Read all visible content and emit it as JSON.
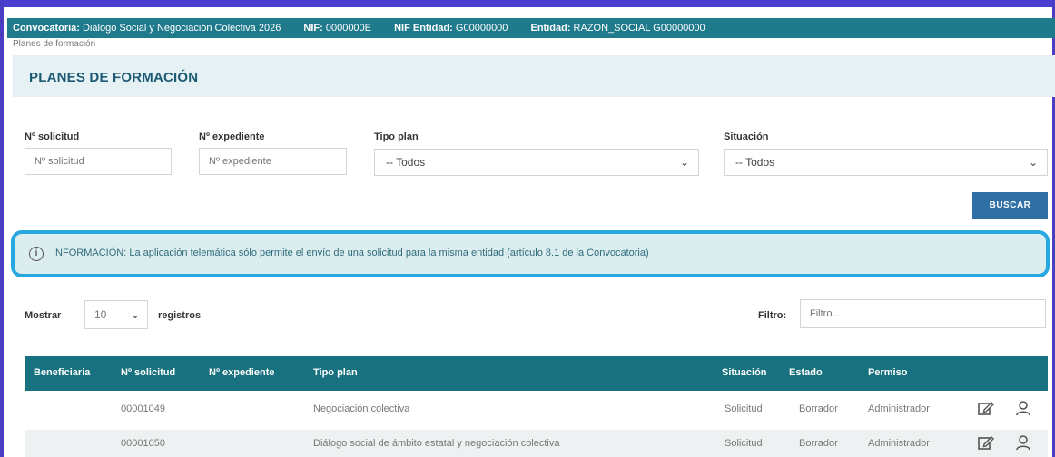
{
  "header": {
    "convocatoria_label": "Convocatoria:",
    "convocatoria_value": "Diálogo Social y Negociación Colectiva 2026",
    "nif_label": "NIF:",
    "nif_value": "0000000E",
    "nif_entidad_label": "NIF Entidad:",
    "nif_entidad_value": "G00000000",
    "entidad_label": "Entidad:",
    "entidad_value": "RAZON_SOCIAL G00000000"
  },
  "breadcrumb": "Planes de formación",
  "page_title": "PLANES DE FORMACIÓN",
  "filters": {
    "solicitud_label": "Nº solicitud",
    "solicitud_placeholder": "Nº solicitud",
    "expediente_label": "Nº expediente",
    "expediente_placeholder": "Nº expediente",
    "tipo_plan_label": "Tipo plan",
    "tipo_plan_value": "-- Todos",
    "situacion_label": "Situación",
    "situacion_value": "-- Todos",
    "search_button": "BUSCAR"
  },
  "info": {
    "text": "INFORMACIÓN: La aplicación telemática sólo permite el envío de una solicitud para la misma entidad (artículo 8.1 de la Convocatoria)"
  },
  "table_controls": {
    "mostrar_label": "Mostrar",
    "page_length": "10",
    "registros_label": "registros",
    "filtro_label": "Filtro:",
    "filtro_placeholder": "Filtro..."
  },
  "table": {
    "columns": [
      "Beneficiaria",
      "Nº solicitud",
      "Nº expediente",
      "Tipo plan",
      "Situación",
      "Estado",
      "Permiso"
    ],
    "rows": [
      {
        "beneficiaria": "",
        "solicitud": "00001049",
        "expediente": "",
        "tipo_plan": "Negociación colectiva",
        "situacion": "Solicitud",
        "estado": "Borrador",
        "permiso": "Administrador"
      },
      {
        "beneficiaria": "",
        "solicitud": "00001050",
        "expediente": "",
        "tipo_plan": "Diálogo social de ámbito estatal y negociación colectiva",
        "situacion": "Solicitud",
        "estado": "Borrador",
        "permiso": "Administrador"
      }
    ]
  },
  "colors": {
    "header_bg": "#1f7a8c",
    "table_head_bg": "#17717f",
    "button_bg": "#2f6fa6",
    "info_border": "#29a8df",
    "title_color": "#1c5b73"
  },
  "icons": [
    "info-icon",
    "chevron-down-icon",
    "edit-icon",
    "user-icon"
  ]
}
